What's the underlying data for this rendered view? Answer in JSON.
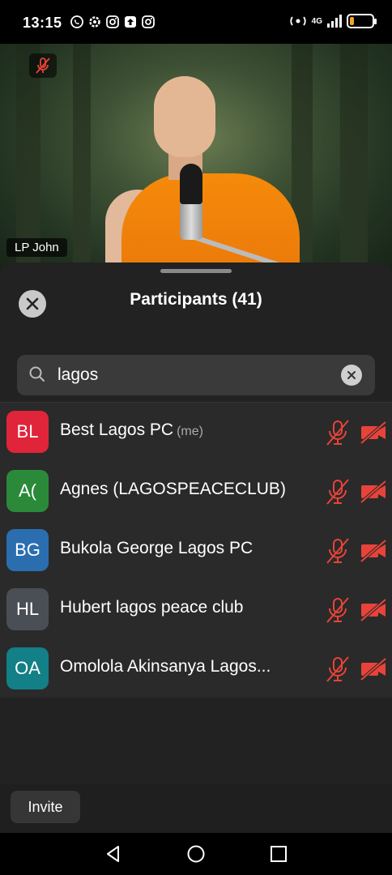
{
  "status_bar": {
    "time": "13:15",
    "network": "4G",
    "left_icons": [
      "whatsapp-icon",
      "settings-icon",
      "instagram-icon",
      "upload-icon",
      "instagram-icon"
    ],
    "battery_level": 0.2,
    "battery_color": "#f5a623"
  },
  "video": {
    "speaker_name": "LP John",
    "mic_muted": true
  },
  "panel": {
    "title": "Participants (41)",
    "search_value": "lagos",
    "search_placeholder": "Search"
  },
  "participants": [
    {
      "initials": "BL",
      "name": "Best Lagos PC",
      "suffix": "(me)",
      "color": "#e0243a",
      "mic_muted": true,
      "video_off": true
    },
    {
      "initials": "A(",
      "name": "Agnes (LAGOSPEACECLUB)",
      "suffix": "",
      "color": "#2a8a3a",
      "mic_muted": true,
      "video_off": true
    },
    {
      "initials": "BG",
      "name": "Bukola George Lagos PC",
      "suffix": "",
      "color": "#2a6eb0",
      "mic_muted": true,
      "video_off": true
    },
    {
      "initials": "HL",
      "name": "Hubert lagos peace club",
      "suffix": "",
      "color": "#4a4e55",
      "mic_muted": true,
      "video_off": true
    },
    {
      "initials": "OA",
      "name": "Omolola Akinsanya Lagos...",
      "suffix": "",
      "color": "#137f86",
      "mic_muted": true,
      "video_off": true
    }
  ],
  "footer": {
    "invite_label": "Invite"
  },
  "colors": {
    "muted_red": "#e8433a",
    "panel_bg": "#222222",
    "list_bg": "#2a2a2a"
  }
}
